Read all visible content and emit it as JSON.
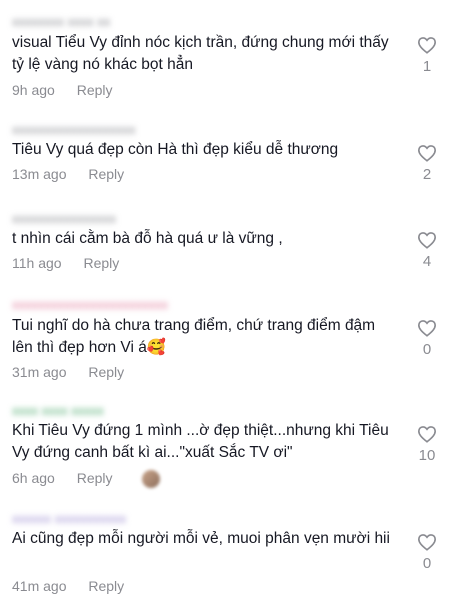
{
  "comments": [
    {
      "name": "xxxxxxxx xxxx xx",
      "text": "visual Tiểu Vy đỉnh nóc kịch trần, đứng chung mới thấy tỷ lệ vàng nó khác bọt hẳn",
      "time": "9h ago",
      "reply": "Reply",
      "likes": "1"
    },
    {
      "name": "xxxxxxxxxxxxxxxxxxx",
      "text": "Tiêu Vy quá đẹp còn Hà thì đẹp kiểu dễ thương",
      "time": "13m ago",
      "reply": "Reply",
      "likes": "2"
    },
    {
      "name": "xxxxxxxxxxxxxxxx",
      "text": "t nhìn cái cằm bà đỗ hà quá ư là vững ,",
      "time": "11h ago",
      "reply": "Reply",
      "likes": "4"
    },
    {
      "name": "xxxxxxxxxxxxxxxxxxxxxxxx",
      "text": "Tui nghĩ do hà chưa trang điểm, chứ trang điểm đậm lên thì đẹp hơn Vi á🥰",
      "time": "31m ago",
      "reply": "Reply",
      "likes": "0"
    },
    {
      "name": "xxxx xxxx xxxxx",
      "text": "Khi Tiêu Vy đứng 1 mình ...ờ đẹp thiệt...nhưng khi Tiêu Vy đứng canh bất kì ai...\"xuất Sắc TV ơi\"",
      "time": "6h ago",
      "reply": "Reply",
      "likes": "10"
    },
    {
      "name": "xxxxxx xxxxxxxxxxx",
      "text": "Ai cũng đẹp mỗi người mỗi vẻ, muoi phân vẹn mười hii",
      "time": "41m ago",
      "reply": "Reply",
      "likes": "0"
    }
  ]
}
